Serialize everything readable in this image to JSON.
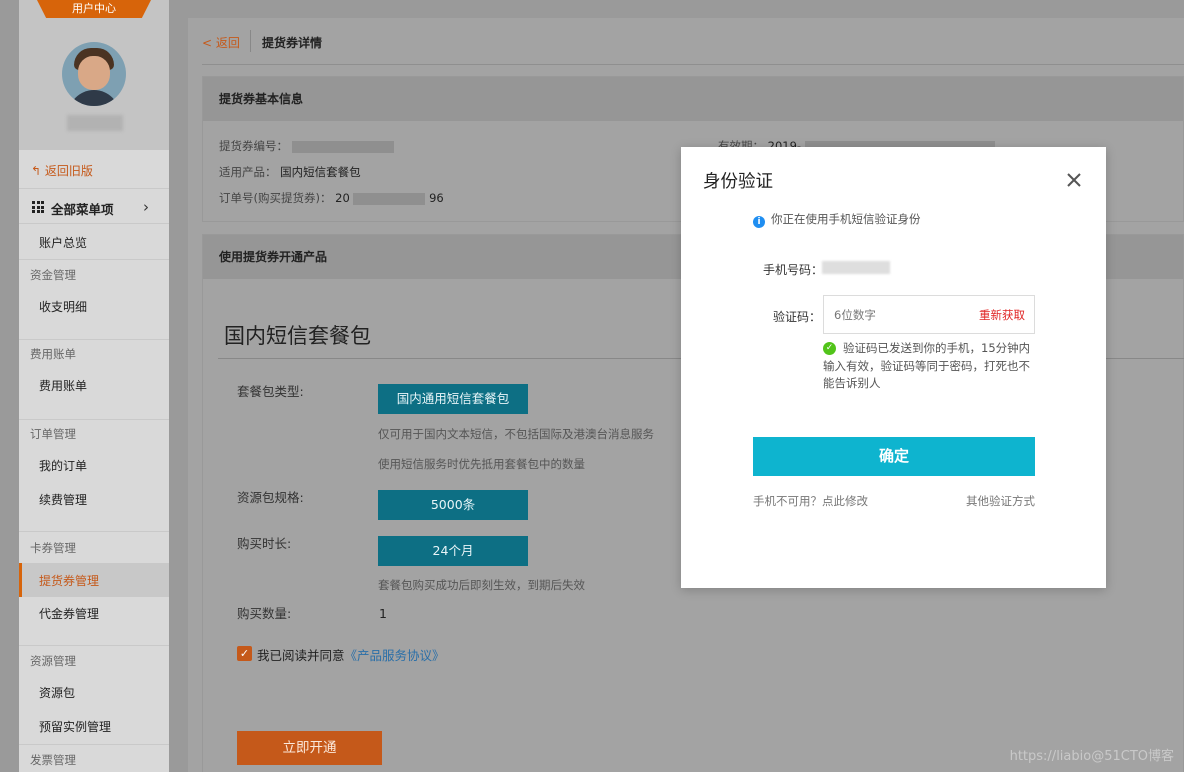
{
  "sidebar": {
    "banner": "用户中心",
    "back_old": "返回旧版",
    "all_menu": "全部菜单项",
    "account_overview": "账户总览",
    "groups": [
      {
        "title": "资金管理",
        "items": [
          "收支明细"
        ]
      },
      {
        "title": "费用账单",
        "items": [
          "费用账单"
        ]
      },
      {
        "title": "订单管理",
        "items": [
          "我的订单",
          "续费管理"
        ]
      },
      {
        "title": "卡券管理",
        "items": [
          "提货券管理",
          "代金券管理"
        ]
      },
      {
        "title": "资源管理",
        "items": [
          "资源包",
          "预留实例管理"
        ]
      },
      {
        "title": "发票管理",
        "items": []
      }
    ],
    "active_item": "提货券管理"
  },
  "topbar": {
    "back": "< 返回",
    "title": "提货券详情"
  },
  "basic_info": {
    "header": "提货券基本信息",
    "voucher_no_label": "提货券编号：",
    "product_label": "适用产品：",
    "product_value": "国内短信套餐包",
    "order_label": "订单号(购买提货券)：",
    "order_prefix": "20",
    "order_suffix": "96",
    "validity_label": "有效期：",
    "validity_value": "2019-"
  },
  "activate": {
    "header": "使用提货券开通产品",
    "product_title": "国内短信套餐包",
    "package_type_label": "套餐包类型:",
    "package_type_value": "国内通用短信套餐包",
    "hint1": "仅可用于国内文本短信，不包括国际及港澳台消息服务",
    "hint2": "使用短信服务时优先抵用套餐包中的数量",
    "spec_label": "资源包规格:",
    "spec_value": "5000条",
    "duration_label": "购买时长:",
    "duration_value": "24个月",
    "duration_hint": "套餐包购买成功后即刻生效，到期后失效",
    "qty_label": "购买数量:",
    "qty_value": "1",
    "agree_text": "我已阅读并同意",
    "agree_link": "《产品服务协议》",
    "open_button": "立即开通"
  },
  "watermark": "https://liabio@51CTO博客",
  "modal": {
    "title": "身份验证",
    "notice": "你正在使用手机短信验证身份",
    "phone_label": "手机号码：",
    "code_label": "验证码：",
    "code_placeholder": "6位数字",
    "resend": "重新获取",
    "sent_msg": "验证码已发送到你的手机，15分钟内输入有效，验证码等同于密码，打死也不能告诉别人",
    "confirm": "确定",
    "phone_unavailable": "手机不可用？点此修改",
    "other_methods": "其他验证方式"
  }
}
